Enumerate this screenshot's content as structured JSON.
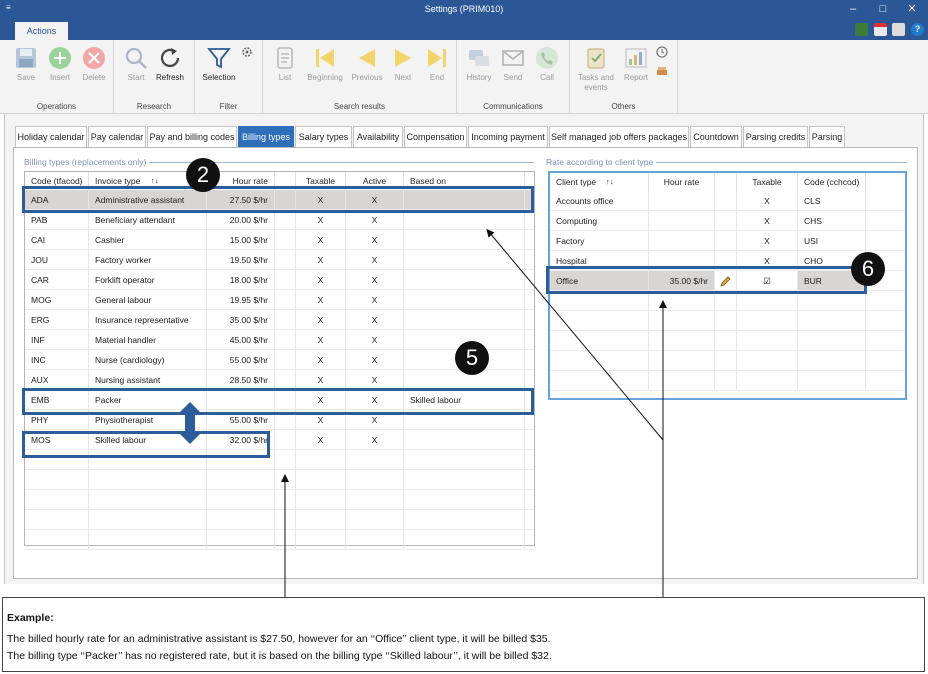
{
  "window": {
    "title": "Settings (PRIM010)",
    "menu_glyph": "≡",
    "minimize": "–",
    "maximize": "□",
    "close": "✕"
  },
  "ribbon": {
    "active_tab": "Actions",
    "groups": {
      "operations": {
        "label": "Operations",
        "buttons": [
          "Save",
          "Insert",
          "Delete"
        ]
      },
      "research": {
        "label": "Research",
        "buttons": [
          "Start",
          "Refresh"
        ]
      },
      "filter": {
        "label": "Filter",
        "buttons": [
          "Selection"
        ]
      },
      "search_results": {
        "label": "Search results",
        "buttons": [
          "List",
          "Beginning",
          "Previous",
          "Next",
          "End"
        ]
      },
      "communications": {
        "label": "Communications",
        "buttons": [
          "History",
          "Send",
          "Call"
        ]
      },
      "others": {
        "label": "Others",
        "buttons": [
          "Tasks and events",
          "Report"
        ]
      }
    }
  },
  "tabs": [
    "Holiday calendar",
    "Pay calendar",
    "Pay and billing codes",
    "Billing types",
    "Salary types",
    "Availability",
    "Compensation",
    "Incoming payment",
    "Self managed job offers packages",
    "Countdown",
    "Parsing credits",
    "Parsing"
  ],
  "active_tab_index": 3,
  "billing": {
    "group_title": "Billing types (replacements only)",
    "columns": [
      "Code (tfacod)",
      "Invoice type",
      "Hour rate",
      "Taxable",
      "Active",
      "Based on"
    ],
    "sort_glyph": "↑↓",
    "rows": [
      {
        "code": "ADA",
        "type": "Administrative assistant",
        "rate": "27.50 $/hr",
        "taxable": "X",
        "active": "X",
        "based_on": ""
      },
      {
        "code": "PAB",
        "type": "Beneficiary attendant",
        "rate": "20.00 $/hr",
        "taxable": "X",
        "active": "X",
        "based_on": ""
      },
      {
        "code": "CAI",
        "type": "Cashier",
        "rate": "15.00 $/hr",
        "taxable": "X",
        "active": "X",
        "based_on": ""
      },
      {
        "code": "JOU",
        "type": "Factory worker",
        "rate": "19.50 $/hr",
        "taxable": "X",
        "active": "X",
        "based_on": ""
      },
      {
        "code": "CAR",
        "type": "Forklift operator",
        "rate": "18.00 $/hr",
        "taxable": "X",
        "active": "X",
        "based_on": ""
      },
      {
        "code": "MOG",
        "type": "General labour",
        "rate": "19.95 $/hr",
        "taxable": "X",
        "active": "X",
        "based_on": ""
      },
      {
        "code": "ERG",
        "type": "Insurance representative",
        "rate": "35.00 $/hr",
        "taxable": "X",
        "active": "X",
        "based_on": ""
      },
      {
        "code": "INF",
        "type": "Material handler",
        "rate": "45.00 $/hr",
        "taxable": "X",
        "active": "X",
        "based_on": ""
      },
      {
        "code": "INC",
        "type": "Nurse (cardiology)",
        "rate": "55.00 $/hr",
        "taxable": "X",
        "active": "X",
        "based_on": ""
      },
      {
        "code": "AUX",
        "type": "Nursing assistant",
        "rate": "28.50 $/hr",
        "taxable": "X",
        "active": "X",
        "based_on": ""
      },
      {
        "code": "EMB",
        "type": "Packer",
        "rate": "",
        "taxable": "X",
        "active": "X",
        "based_on": "Skilled labour"
      },
      {
        "code": "PHY",
        "type": "Physiotherapist",
        "rate": "55.00 $/hr",
        "taxable": "X",
        "active": "X",
        "based_on": ""
      },
      {
        "code": "MOS",
        "type": "Skilled labour",
        "rate": "32.00 $/hr",
        "taxable": "X",
        "active": "X",
        "based_on": ""
      }
    ]
  },
  "rates": {
    "group_title": "Rate according to client type",
    "columns": [
      "Client type",
      "Hour rate",
      "",
      "Taxable",
      "Code (cchcod)"
    ],
    "sort_glyph": "↑↓",
    "rows": [
      {
        "client": "Accounts office",
        "rate": "",
        "taxable": "X",
        "code": "CLS"
      },
      {
        "client": "Computing",
        "rate": "",
        "taxable": "X",
        "code": "CHS"
      },
      {
        "client": "Factory",
        "rate": "",
        "taxable": "X",
        "code": "USI"
      },
      {
        "client": "Hospital",
        "rate": "",
        "taxable": "X",
        "code": "CHO"
      },
      {
        "client": "Office",
        "rate": "35.00 $/hr",
        "taxable": "☑",
        "code": "BUR"
      }
    ]
  },
  "callouts": {
    "two": "2",
    "five": "5",
    "six": "6"
  },
  "note": {
    "title": "Example:",
    "line1": "The billed hourly rate for an administrative assistant is $27.50, however for an ‘‘Office’’ client type, it will be billed $35.",
    "line2": "The billing type ‘‘Packer’’ has no registered rate, but it is based on the billing type ‘‘Skilled labour’’, it will be billed $32."
  },
  "colors": {
    "title_bar": "#2b5797",
    "active_tab": "#2e6fbc",
    "highlight": "#2c5c9a",
    "selected_row": "#d9d5d2"
  },
  "icons": [
    "save-icon",
    "insert-icon",
    "delete-icon",
    "search-icon",
    "refresh-icon",
    "filter-icon",
    "list-icon",
    "first-icon",
    "previous-icon",
    "next-icon",
    "last-icon",
    "history-icon",
    "send-icon",
    "call-icon",
    "tasks-icon",
    "report-icon",
    "pencil-icon",
    "checkbox-icon"
  ]
}
